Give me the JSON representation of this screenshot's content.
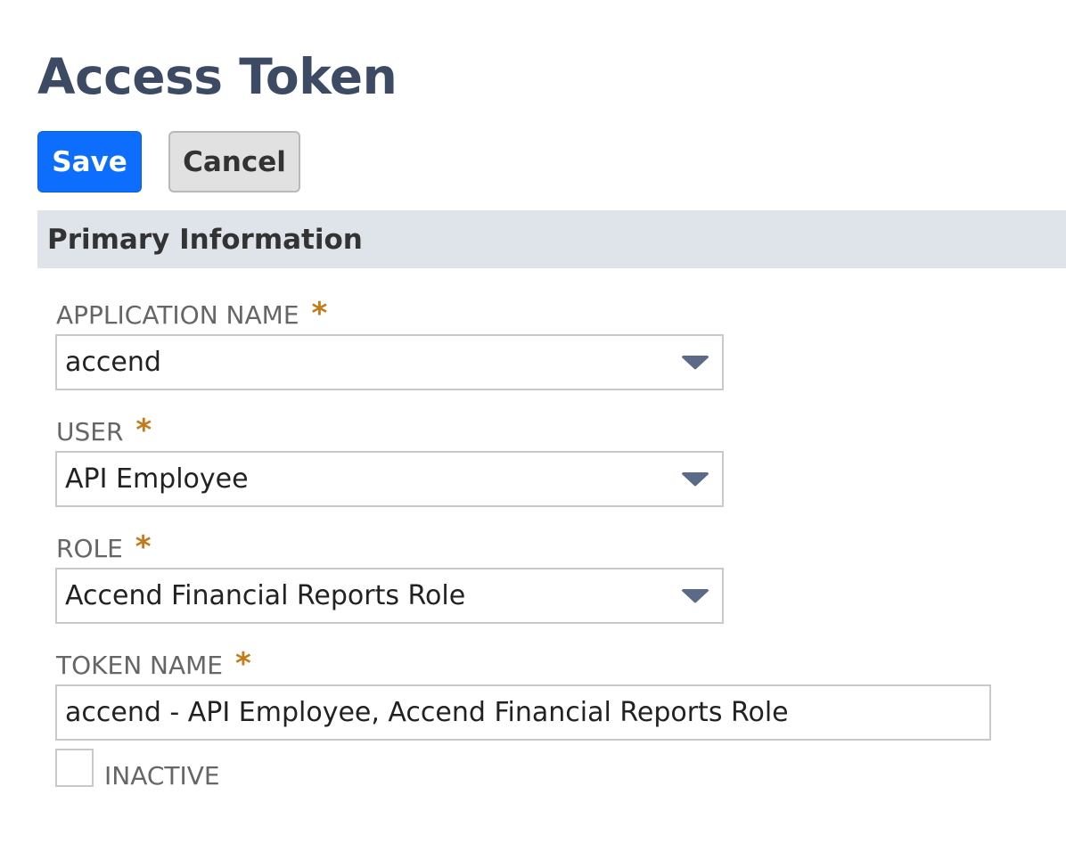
{
  "page": {
    "title": "Access Token"
  },
  "toolbar": {
    "save_label": "Save",
    "cancel_label": "Cancel"
  },
  "section": {
    "title": "Primary Information"
  },
  "fields": {
    "application_name": {
      "label": "APPLICATION NAME",
      "value": "accend",
      "required_marker": "*"
    },
    "user": {
      "label": "USER",
      "value": "API Employee",
      "required_marker": "*"
    },
    "role": {
      "label": "ROLE",
      "value": "Accend Financial Reports Role",
      "required_marker": "*"
    },
    "token_name": {
      "label": "TOKEN NAME",
      "value": "accend - API Employee, Accend Financial Reports Role",
      "required_marker": "*"
    },
    "inactive": {
      "label": "INACTIVE",
      "checked": false
    }
  },
  "icons": {
    "dropdown": "chevron-down-icon"
  },
  "colors": {
    "primary_button": "#0d6efd",
    "title": "#3d4a63",
    "required_star": "#c17c1b",
    "section_header_bg": "#dfe4eb"
  }
}
